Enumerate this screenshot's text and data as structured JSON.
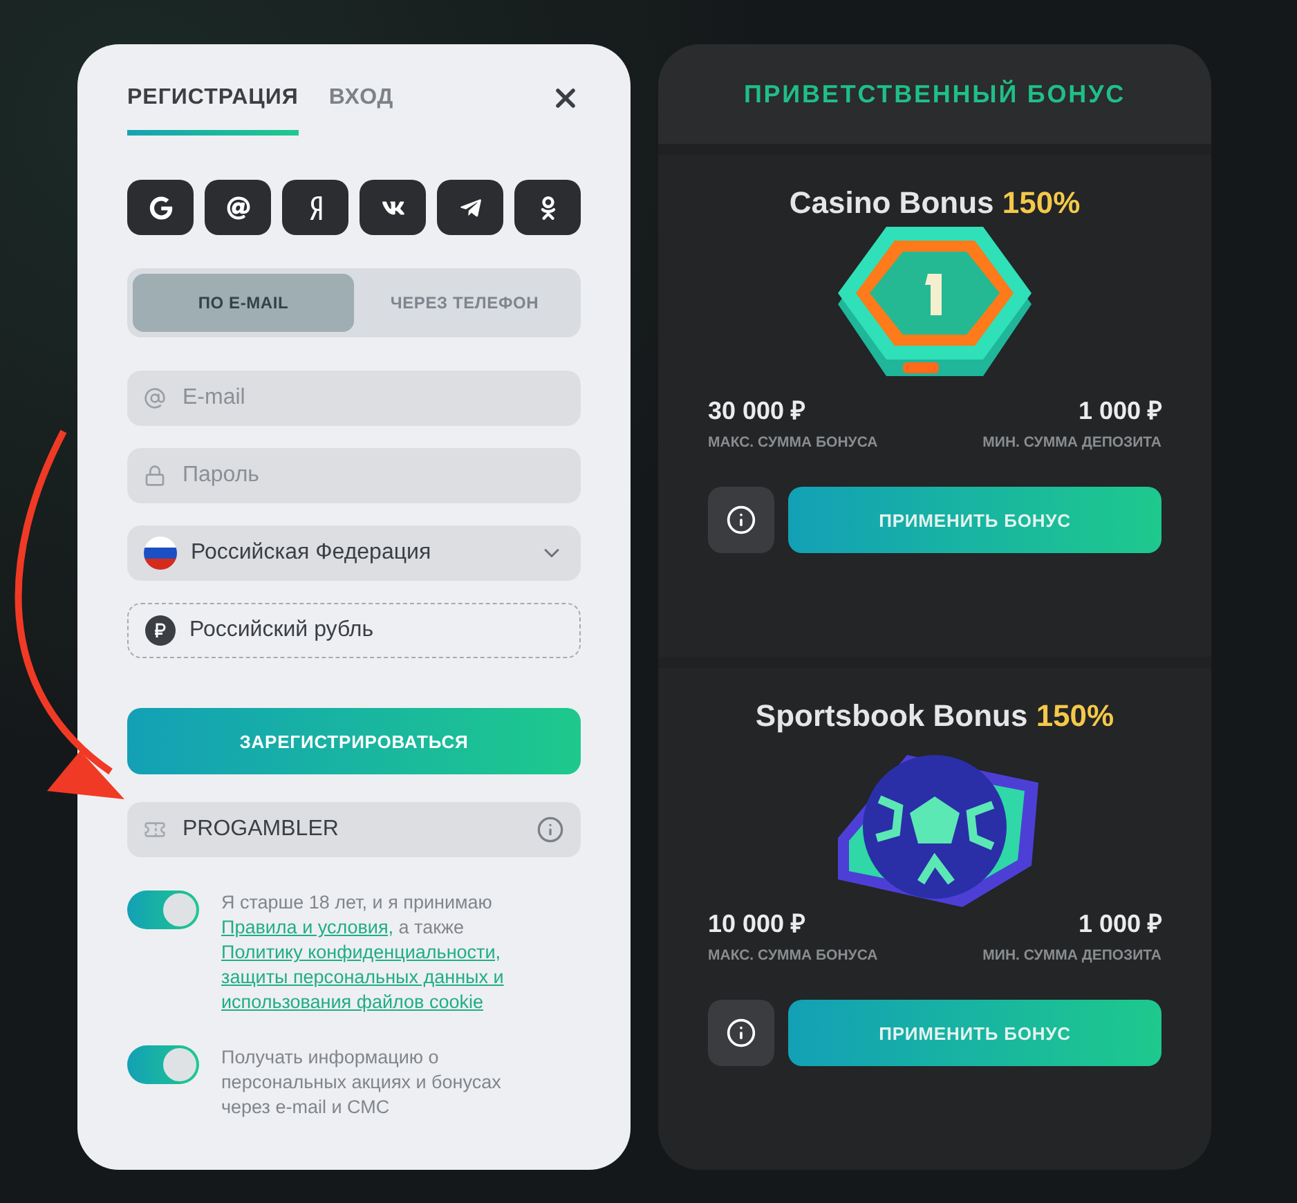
{
  "registration": {
    "tabs": [
      {
        "label": "РЕГИСТРАЦИЯ",
        "selected": true
      },
      {
        "label": "ВХОД",
        "selected": false
      }
    ],
    "social_logins": [
      {
        "kind": "google"
      },
      {
        "kind": "mail"
      },
      {
        "kind": "yandex"
      },
      {
        "kind": "vk"
      },
      {
        "kind": "telegram"
      },
      {
        "kind": "ok"
      }
    ],
    "method_switch": [
      {
        "label": "ПО E-MAIL",
        "selected": true
      },
      {
        "label": "ЧЕРЕЗ ТЕЛЕФОН",
        "selected": false
      }
    ],
    "fields": [
      {
        "kind": "email",
        "placeholder": "E-mail"
      },
      {
        "kind": "password",
        "placeholder": "Пароль"
      },
      {
        "kind": "country",
        "value": "Российская Федерация"
      },
      {
        "kind": "currency",
        "value": "Российский рубль"
      }
    ],
    "register_button": "ЗАРЕГИСТРИРОВАТЬСЯ",
    "promo_code": {
      "value": "PROGAMBLER"
    },
    "consents": [
      {
        "on": true,
        "parts": [
          {
            "kind": "text",
            "text": "Я старше 18 лет, и я принимаю"
          },
          {
            "kind": "link",
            "text": "Правила и условия,"
          },
          {
            "kind": "text",
            "text": "а также"
          },
          {
            "kind": "link",
            "text": "Политику конфиденциальности,"
          },
          {
            "kind": "link",
            "text": "защиты персональных данных и"
          },
          {
            "kind": "link",
            "text": "использования файлов cookie"
          }
        ]
      },
      {
        "on": true,
        "parts": [
          {
            "kind": "text",
            "text": "Получать информацию о персональных акциях и бонусах через e-mail и СМС"
          }
        ]
      }
    ]
  },
  "bonus_panel": {
    "title": "ПРИВЕТСТВЕННЫЙ БОНУС",
    "bonuses": [
      {
        "kind": "casino",
        "title": "Casino Bonus",
        "percent": "150%",
        "max_amount": "30 000 ₽",
        "max_label": "МАКС. СУММА БОНУСА",
        "min_amount": "1 000 ₽",
        "min_label": "МИН. СУММА ДЕПОЗИТА",
        "button": "ПРИМЕНИТЬ БОНУС"
      },
      {
        "kind": "sports",
        "title": "Sportsbook Bonus",
        "percent": "150%",
        "max_amount": "10 000 ₽",
        "max_label": "МАКС. СУММА БОНУСА",
        "min_amount": "1 000 ₽",
        "min_label": "МИН. СУММА ДЕПОЗИТА",
        "button": "ПРИМЕНИТЬ БОНУС"
      }
    ]
  }
}
